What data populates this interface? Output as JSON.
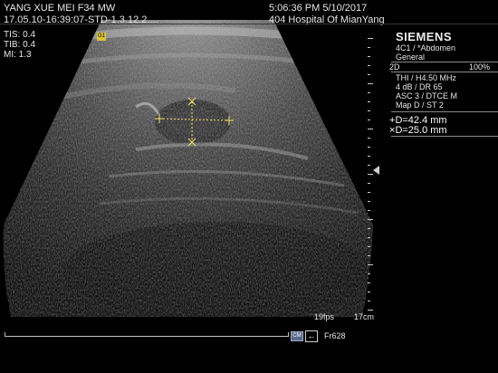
{
  "header": {
    "patient": "YANG XUE MEI F34 MW",
    "study_id": "17.05.10-16:39:07-STD-1.3.12.2....",
    "datetime": "5:06:36 PM 5/10/2017",
    "hospital": "404 Hospital Of MianYang"
  },
  "indices": {
    "tis": "TIS: 0.4",
    "tib": "TIB: 0.4",
    "mi": "MI:   1.3"
  },
  "side_panel": {
    "brand": "SIEMENS",
    "probe": "4C1 / *Abdomen",
    "preset": "General",
    "mode": "2D",
    "power": "100%",
    "thi": "THI / H4.50 MHz",
    "gain": "4 dB / DR 65",
    "asc": "ASC 3 / DTCE M",
    "map": "Map D / ST 2"
  },
  "measurements": [
    {
      "symbol": "+",
      "label": "D=42.4 mm"
    },
    {
      "symbol": "×",
      "label": "D=25.0 mm"
    }
  ],
  "status": {
    "fps": "19fps",
    "depth": "17cm",
    "frame": "Fr628",
    "cine_chip": "CM",
    "indicator": "G1"
  },
  "icons": {
    "back": "arrow-left-icon",
    "cine": "cine-icon"
  },
  "colors": {
    "caliper": "#f2e86a",
    "panel_line": "#8a8a8a",
    "brand": "#f0f0f0"
  }
}
